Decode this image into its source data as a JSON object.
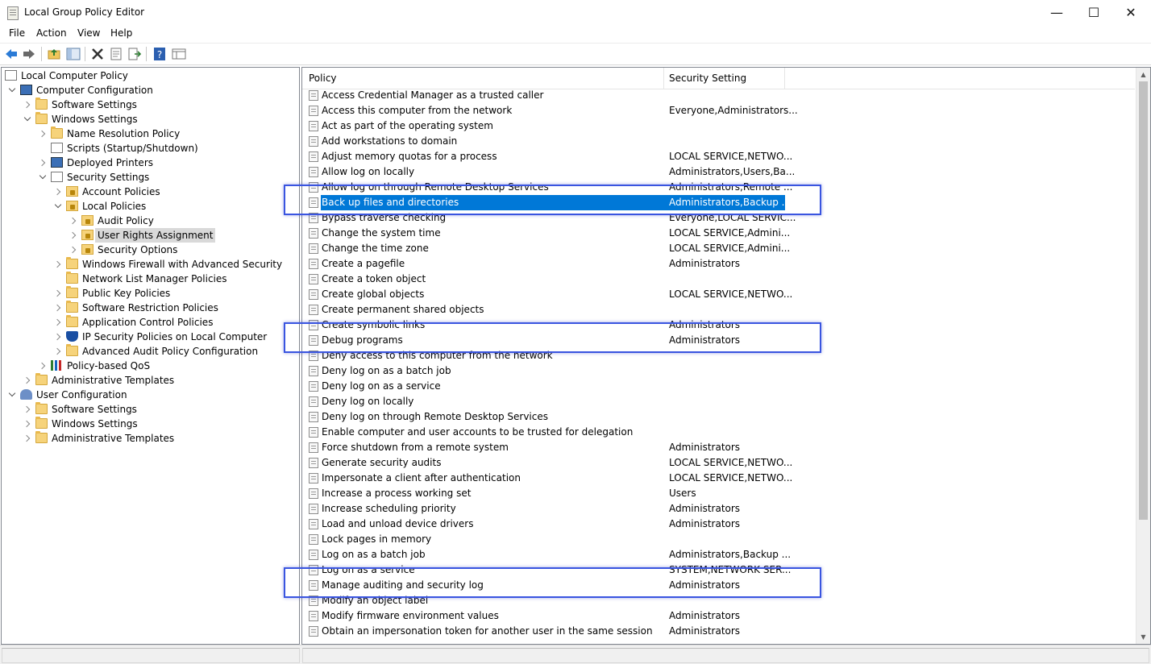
{
  "window": {
    "title": "Local Group Policy Editor",
    "minimize": "—",
    "maximize": "☐",
    "close": "✕"
  },
  "menu": [
    "File",
    "Action",
    "View",
    "Help"
  ],
  "toolbar": [
    {
      "name": "back-arrow-icon"
    },
    {
      "name": "forward-arrow-icon"
    },
    {
      "name": "up-folder-icon"
    },
    {
      "name": "show-hide-tree-icon"
    },
    {
      "name": "delete-icon"
    },
    {
      "name": "properties-icon"
    },
    {
      "name": "export-list-icon"
    },
    {
      "name": "help-icon"
    },
    {
      "name": "console-tree-icon"
    }
  ],
  "tree": [
    {
      "label": "Local Computer Policy",
      "icon": "doc",
      "chev": "none",
      "level": 0
    },
    {
      "label": "Computer Configuration",
      "icon": "computer",
      "chev": "open",
      "level": 1
    },
    {
      "label": "Software Settings",
      "icon": "folder",
      "chev": "closed",
      "level": 2
    },
    {
      "label": "Windows Settings",
      "icon": "folder",
      "chev": "open",
      "level": 2
    },
    {
      "label": "Name Resolution Policy",
      "icon": "folder",
      "chev": "closed",
      "level": 3
    },
    {
      "label": "Scripts (Startup/Shutdown)",
      "icon": "doc",
      "chev": "none",
      "level": 3
    },
    {
      "label": "Deployed Printers",
      "icon": "computer",
      "chev": "closed",
      "level": 3
    },
    {
      "label": "Security Settings",
      "icon": "doc",
      "chev": "open",
      "level": 3
    },
    {
      "label": "Account Policies",
      "icon": "lockfolder",
      "chev": "closed",
      "level": 4
    },
    {
      "label": "Local Policies",
      "icon": "lockfolder",
      "chev": "open",
      "level": 4
    },
    {
      "label": "Audit Policy",
      "icon": "lockfolder",
      "chev": "closed",
      "level": 5
    },
    {
      "label": "User Rights Assignment",
      "icon": "lockfolder",
      "chev": "closed",
      "level": 5,
      "selected": true
    },
    {
      "label": "Security Options",
      "icon": "lockfolder",
      "chev": "closed",
      "level": 5
    },
    {
      "label": "Windows Firewall with Advanced Security",
      "icon": "folder",
      "chev": "closed",
      "level": 4
    },
    {
      "label": "Network List Manager Policies",
      "icon": "folder",
      "chev": "none",
      "level": 4
    },
    {
      "label": "Public Key Policies",
      "icon": "folder",
      "chev": "closed",
      "level": 4
    },
    {
      "label": "Software Restriction Policies",
      "icon": "folder",
      "chev": "closed",
      "level": 4
    },
    {
      "label": "Application Control Policies",
      "icon": "folder",
      "chev": "closed",
      "level": 4
    },
    {
      "label": "IP Security Policies on Local Computer",
      "icon": "shield",
      "chev": "closed",
      "level": 4
    },
    {
      "label": "Advanced Audit Policy Configuration",
      "icon": "folder",
      "chev": "closed",
      "level": 4
    },
    {
      "label": "Policy-based QoS",
      "icon": "chart",
      "chev": "closed",
      "level": 3
    },
    {
      "label": "Administrative Templates",
      "icon": "folder",
      "chev": "closed",
      "level": 2
    },
    {
      "label": "User Configuration",
      "icon": "user",
      "chev": "open",
      "level": 1
    },
    {
      "label": "Software Settings",
      "icon": "folder",
      "chev": "closed",
      "level": 2
    },
    {
      "label": "Windows Settings",
      "icon": "folder",
      "chev": "closed",
      "level": 2
    },
    {
      "label": "Administrative Templates",
      "icon": "folder",
      "chev": "closed",
      "level": 2
    }
  ],
  "list": {
    "headers": {
      "policy": "Policy",
      "setting": "Security Setting"
    },
    "sort_arrow": "^",
    "rows": [
      {
        "policy": "Access Credential Manager as a trusted caller",
        "setting": ""
      },
      {
        "policy": "Access this computer from the network",
        "setting": "Everyone,Administrators..."
      },
      {
        "policy": "Act as part of the operating system",
        "setting": ""
      },
      {
        "policy": "Add workstations to domain",
        "setting": ""
      },
      {
        "policy": "Adjust memory quotas for a process",
        "setting": "LOCAL SERVICE,NETWO..."
      },
      {
        "policy": "Allow log on locally",
        "setting": "Administrators,Users,Ba..."
      },
      {
        "policy": "Allow log on through Remote Desktop Services",
        "setting": "Administrators,Remote ..."
      },
      {
        "policy": "Back up files and directories",
        "setting": "Administrators,Backup ...",
        "selected": true
      },
      {
        "policy": "Bypass traverse checking",
        "setting": "Everyone,LOCAL SERVIC..."
      },
      {
        "policy": "Change the system time",
        "setting": "LOCAL SERVICE,Admini..."
      },
      {
        "policy": "Change the time zone",
        "setting": "LOCAL SERVICE,Admini..."
      },
      {
        "policy": "Create a pagefile",
        "setting": "Administrators"
      },
      {
        "policy": "Create a token object",
        "setting": ""
      },
      {
        "policy": "Create global objects",
        "setting": "LOCAL SERVICE,NETWO..."
      },
      {
        "policy": "Create permanent shared objects",
        "setting": ""
      },
      {
        "policy": "Create symbolic links",
        "setting": "Administrators"
      },
      {
        "policy": "Debug programs",
        "setting": "Administrators"
      },
      {
        "policy": "Deny access to this computer from the network",
        "setting": ""
      },
      {
        "policy": "Deny log on as a batch job",
        "setting": ""
      },
      {
        "policy": "Deny log on as a service",
        "setting": ""
      },
      {
        "policy": "Deny log on locally",
        "setting": ""
      },
      {
        "policy": "Deny log on through Remote Desktop Services",
        "setting": ""
      },
      {
        "policy": "Enable computer and user accounts to be trusted for delegation",
        "setting": ""
      },
      {
        "policy": "Force shutdown from a remote system",
        "setting": "Administrators"
      },
      {
        "policy": "Generate security audits",
        "setting": "LOCAL SERVICE,NETWO..."
      },
      {
        "policy": "Impersonate a client after authentication",
        "setting": "LOCAL SERVICE,NETWO..."
      },
      {
        "policy": "Increase a process working set",
        "setting": "Users"
      },
      {
        "policy": "Increase scheduling priority",
        "setting": "Administrators"
      },
      {
        "policy": "Load and unload device drivers",
        "setting": "Administrators"
      },
      {
        "policy": "Lock pages in memory",
        "setting": ""
      },
      {
        "policy": "Log on as a batch job",
        "setting": "Administrators,Backup ..."
      },
      {
        "policy": "Log on as a service",
        "setting": "SYSTEM,NETWORK SER..."
      },
      {
        "policy": "Manage auditing and security log",
        "setting": "Administrators"
      },
      {
        "policy": "Modify an object label",
        "setting": ""
      },
      {
        "policy": "Modify firmware environment values",
        "setting": "Administrators"
      },
      {
        "policy": "Obtain an impersonation token for another user in the same session",
        "setting": "Administrators"
      }
    ]
  },
  "highlights": [
    "Back up files and directories",
    "Debug programs",
    "Manage auditing and security log"
  ],
  "colors": {
    "selection": "#0078d7",
    "highlight_box": "#3a55e0"
  }
}
